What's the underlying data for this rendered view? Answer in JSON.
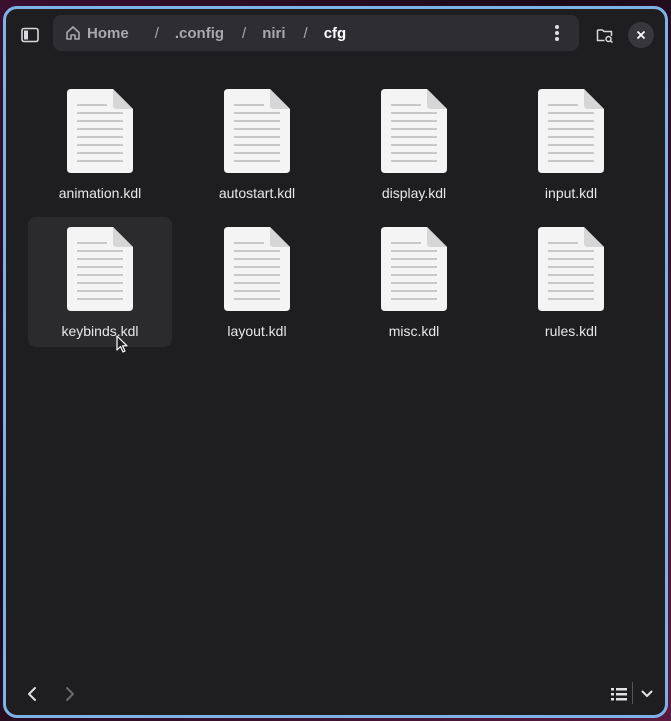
{
  "pathbar": {
    "crumbs": [
      {
        "label": "Home",
        "icon": "home-icon"
      },
      {
        "label": ".config"
      },
      {
        "label": "niri"
      },
      {
        "label": "cfg",
        "current": true
      }
    ],
    "separator": "/"
  },
  "files": [
    {
      "name": "animation.kdl"
    },
    {
      "name": "autostart.kdl"
    },
    {
      "name": "display.kdl"
    },
    {
      "name": "input.kdl"
    },
    {
      "name": "keybinds.kdl",
      "selected": true
    },
    {
      "name": "layout.kdl"
    },
    {
      "name": "misc.kdl"
    },
    {
      "name": "rules.kdl"
    }
  ],
  "colors": {
    "window_border": "#7fb2e6",
    "window_bg": "#1e1e20",
    "pathbar_bg": "#2e2e32"
  },
  "icons": {
    "sidebar": "sidebar-toggle-icon",
    "menu": "more-vertical-icon",
    "search": "folder-search-icon",
    "close": "close-icon",
    "back": "chevron-left-icon",
    "forward": "chevron-right-icon",
    "view": "list-view-icon",
    "dropdown": "chevron-down-icon"
  }
}
